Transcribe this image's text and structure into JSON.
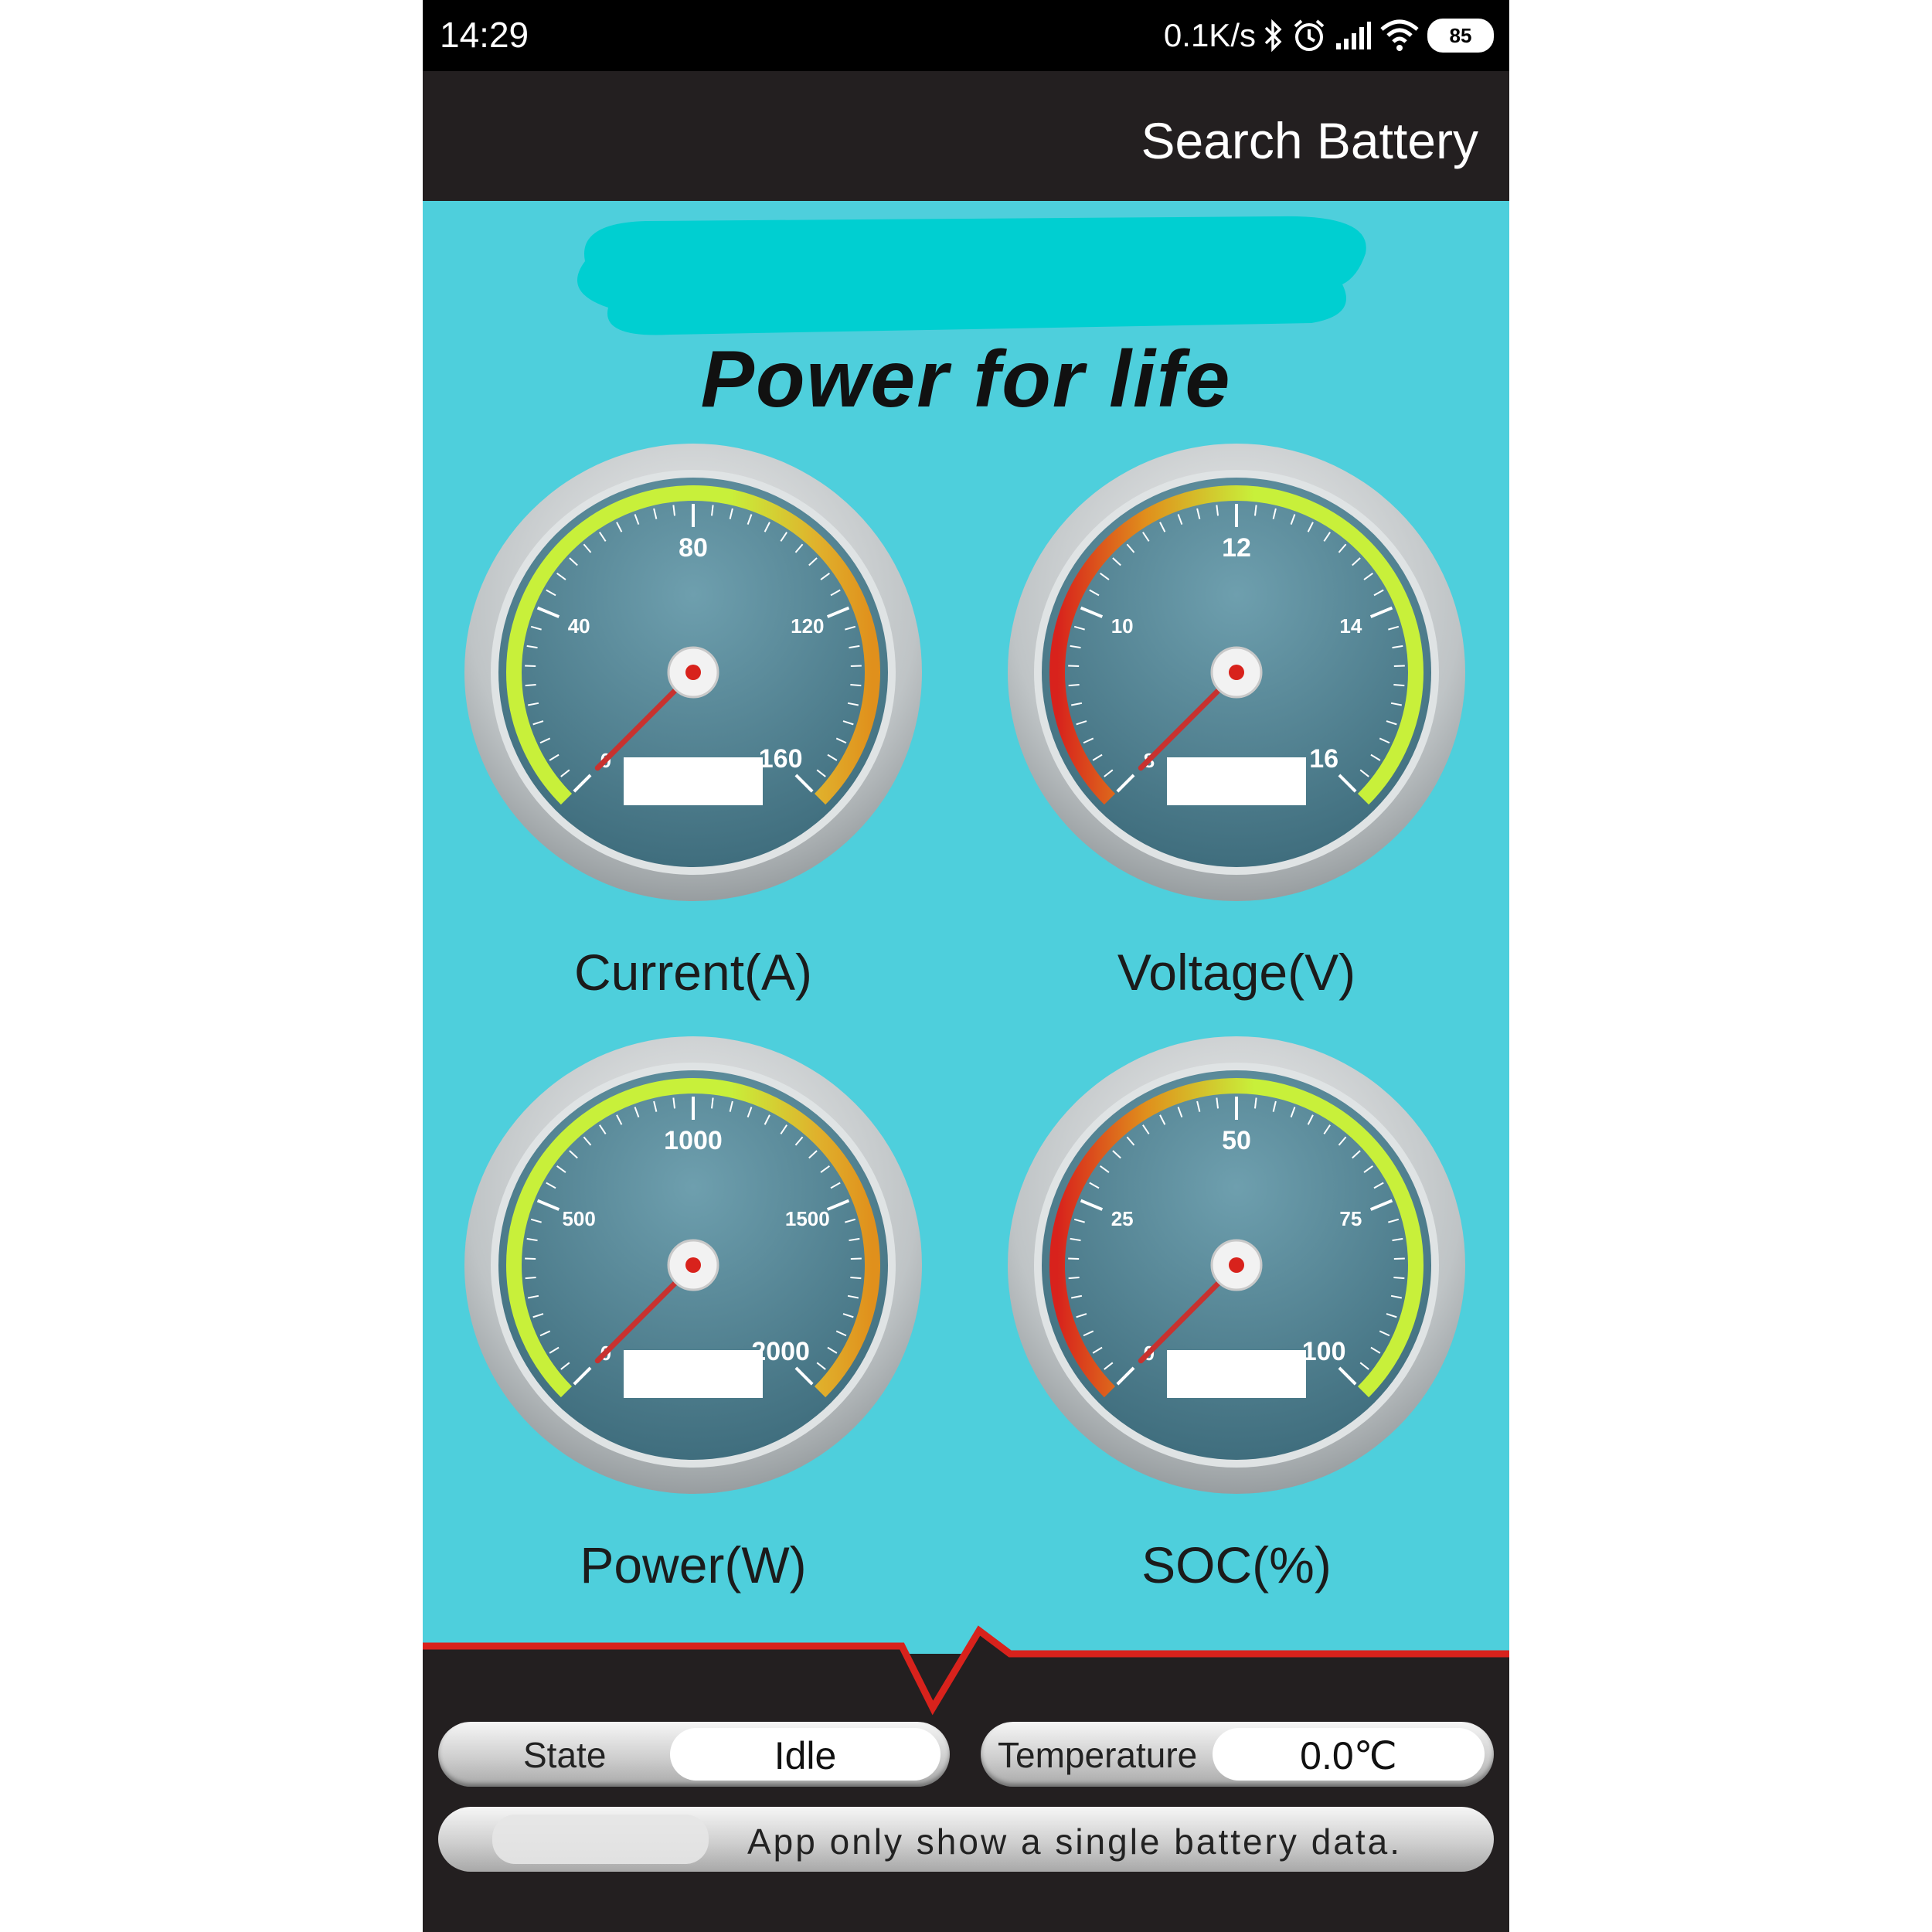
{
  "status_bar": {
    "time": "14:29",
    "network_speed": "0.1K/s",
    "battery_level": "85",
    "icons": [
      "bluetooth-icon",
      "alarm-icon",
      "signal-icon",
      "wifi-icon",
      "battery-icon"
    ]
  },
  "app_bar": {
    "action_label": "Search Battery"
  },
  "header": {
    "slogan": "Power for life"
  },
  "gauges": [
    {
      "name": "current",
      "label": "Current(A)",
      "ticks": [
        "0",
        "40",
        "80",
        "120",
        "160"
      ],
      "readout": "",
      "value_fraction": 0.0,
      "color_scheme": "green-to-orange"
    },
    {
      "name": "voltage",
      "label": "Voltage(V)",
      "ticks": [
        "8",
        "10",
        "12",
        "14",
        "16"
      ],
      "readout": "",
      "value_fraction": 0.0,
      "color_scheme": "red-to-green"
    },
    {
      "name": "power",
      "label": "Power(W)",
      "ticks": [
        "0",
        "500",
        "1000",
        "1500",
        "2000"
      ],
      "readout": "",
      "value_fraction": 0.0,
      "color_scheme": "green-to-orange"
    },
    {
      "name": "soc",
      "label": "SOC(%)",
      "ticks": [
        "0",
        "25",
        "50",
        "75",
        "100"
      ],
      "readout": "",
      "value_fraction": 0.0,
      "color_scheme": "red-to-green"
    }
  ],
  "status_panel": {
    "state_label": "State",
    "state_value": "Idle",
    "temperature_label": "Temperature",
    "temperature_value": "0.0℃",
    "notice": "App only show a single battery data."
  },
  "colors": {
    "background": "#4ecfdc",
    "app_bar": "#231f20",
    "gauge_face": "#4f8090",
    "needle": "#c8322f",
    "accent_red": "#d8221c",
    "green": "#c8f03a",
    "orange": "#e0901c"
  }
}
